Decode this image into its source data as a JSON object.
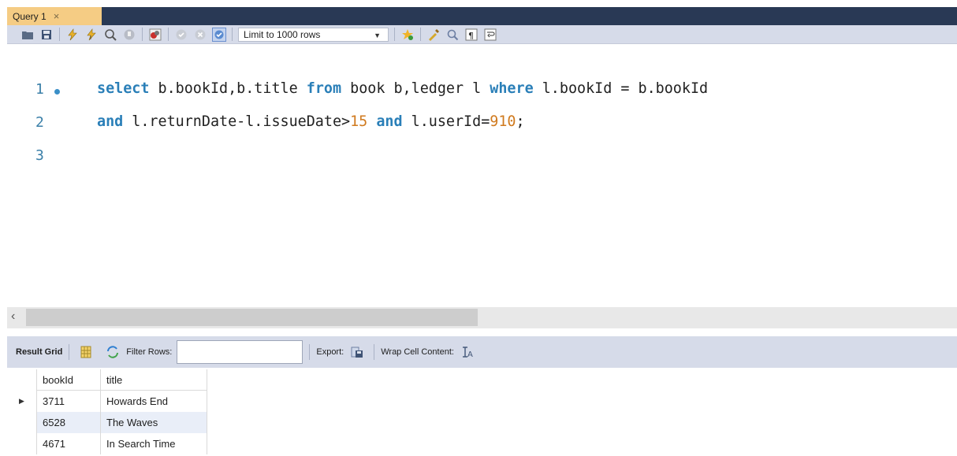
{
  "tab": {
    "label": "Query 1",
    "close": "×"
  },
  "toolbar": {
    "limit_value": "Limit to 1000 rows",
    "icons": [
      "open-folder-icon",
      "save-icon",
      "execute-icon",
      "execute-current-icon",
      "explain-icon",
      "stop-icon",
      "toggle-error-icon",
      "commit-icon",
      "rollback-icon",
      "autocommit-icon",
      "add-snippet-icon",
      "beautify-icon",
      "find-icon",
      "invisible-chars-icon",
      "word-wrap-icon"
    ]
  },
  "editor": {
    "line_numbers": [
      "1",
      "2",
      "3"
    ],
    "lines": [
      [
        {
          "t": "kw",
          "v": "select"
        },
        {
          "t": "tx",
          "v": " b.bookId,b.title "
        },
        {
          "t": "kw",
          "v": "from"
        },
        {
          "t": "tx",
          "v": " book b,ledger l "
        },
        {
          "t": "kw",
          "v": "where"
        },
        {
          "t": "tx",
          "v": " l.bookId = b.bookId"
        }
      ],
      [
        {
          "t": "kw",
          "v": "and"
        },
        {
          "t": "tx",
          "v": " l.returnDate-l.issueDate>"
        },
        {
          "t": "num",
          "v": "15"
        },
        {
          "t": "tx",
          "v": " "
        },
        {
          "t": "kw",
          "v": "and"
        },
        {
          "t": "tx",
          "v": " l.userId="
        },
        {
          "t": "num",
          "v": "910"
        },
        {
          "t": "tx",
          "v": ";"
        }
      ],
      []
    ]
  },
  "scrollbar": {
    "left_arrow": "‹"
  },
  "results_toolbar": {
    "result_grid_label": "Result Grid",
    "filter_rows_label": "Filter Rows:",
    "filter_rows_value": "",
    "export_label": "Export:",
    "wrap_label": "Wrap Cell Content:"
  },
  "grid": {
    "columns": [
      "bookId",
      "title"
    ],
    "rows": [
      [
        "3711",
        "Howards End"
      ],
      [
        "6528",
        "The Waves"
      ],
      [
        "4671",
        "In Search Time"
      ]
    ],
    "selected_row_marker": "▶"
  },
  "colors": {
    "keyword": "#2a7fb8",
    "number": "#d07a1e",
    "tab_active": "#f5cc84",
    "tabstrip": "#293955",
    "toolbar": "#d6dbe9"
  }
}
